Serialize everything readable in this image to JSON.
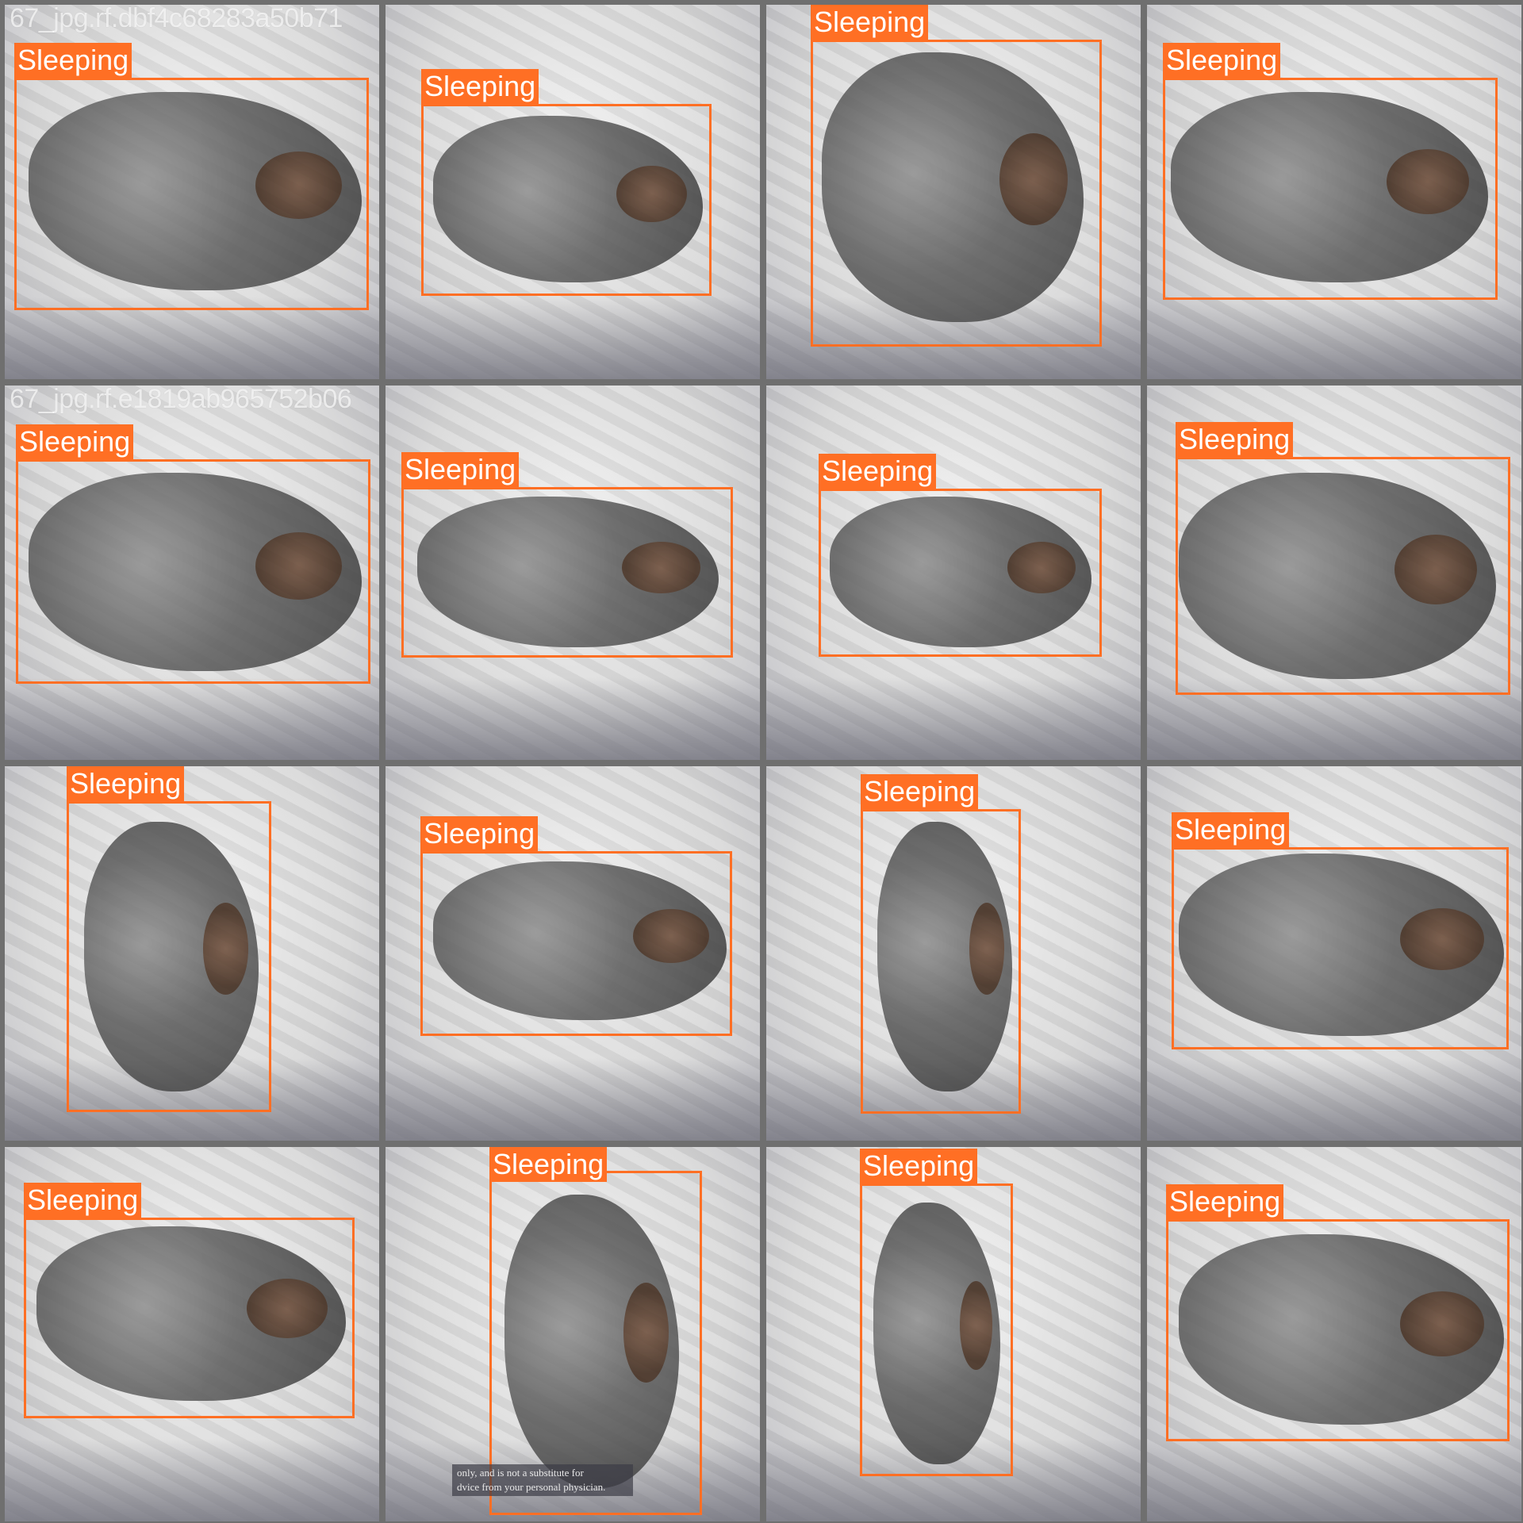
{
  "colors": {
    "box": "#ff6f24",
    "label_text": "#ffffff",
    "tile_border": "#6f6f6f"
  },
  "tiles": [
    {
      "filename": "67_jpg.rf.dbf4c68283a50b71",
      "label": "Sleeping"
    },
    {
      "filename": "",
      "label": "Sleeping"
    },
    {
      "filename": "",
      "label": "Sleeping"
    },
    {
      "filename": "",
      "label": "Sleeping"
    },
    {
      "filename": "67_jpg.rf.e1819ab965752b06",
      "label": "Sleeping"
    },
    {
      "filename": "",
      "label": "Sleeping"
    },
    {
      "filename": "",
      "label": "Sleeping"
    },
    {
      "filename": "",
      "label": "Sleeping"
    },
    {
      "filename": "",
      "label": "Sleeping"
    },
    {
      "filename": "",
      "label": "Sleeping"
    },
    {
      "filename": "",
      "label": "Sleeping"
    },
    {
      "filename": "",
      "label": "Sleeping"
    },
    {
      "filename": "",
      "label": "Sleeping"
    },
    {
      "filename": "",
      "label": "Sleeping"
    },
    {
      "filename": "",
      "label": "Sleeping"
    },
    {
      "filename": "",
      "label": "Sleeping"
    }
  ],
  "watermark": {
    "line1": "only, and is not a substitute for",
    "line2": "dvice from your personal physician."
  }
}
